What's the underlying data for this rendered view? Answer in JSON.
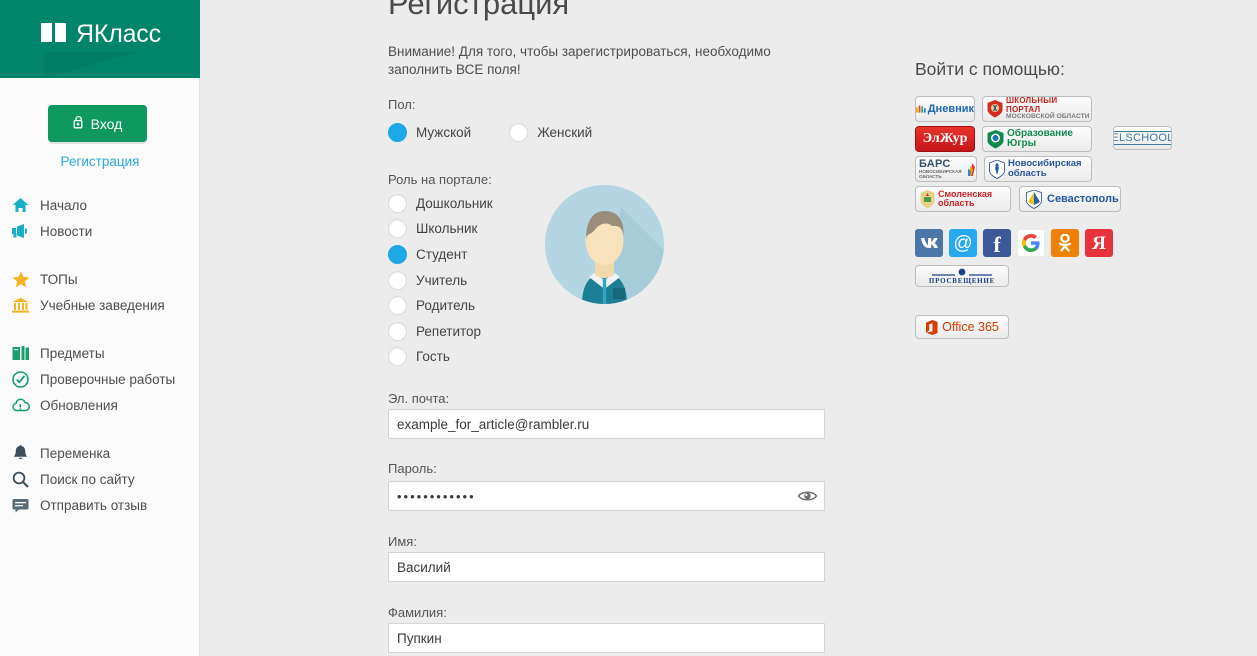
{
  "brand": {
    "logo_text": "ЯКласс",
    "logo_bg": "#00856b",
    "book_icon": "book-icon"
  },
  "sidebar": {
    "login_button": {
      "label": "Вход",
      "icon": "lock-icon",
      "color": "#0f9960"
    },
    "register_link": "Регистрация",
    "groups": [
      {
        "items": [
          {
            "label": "Начало",
            "icon": "home-icon",
            "color": "#17b0c6"
          },
          {
            "label": "Новости",
            "icon": "megaphone-icon",
            "color": "#17b0c6"
          }
        ]
      },
      {
        "items": [
          {
            "label": "ТОПы",
            "icon": "star-icon",
            "color": "#f5b324"
          },
          {
            "label": "Учебные заведения",
            "icon": "bank-icon",
            "color": "#f5b324"
          }
        ]
      },
      {
        "items": [
          {
            "label": "Предметы",
            "icon": "books-icon",
            "color": "#1a9e6e"
          },
          {
            "label": "Проверочные работы",
            "icon": "check-circle-icon",
            "color": "#1a9e6e"
          },
          {
            "label": "Обновления",
            "icon": "cloud-refresh-icon",
            "color": "#1a9e6e"
          }
        ]
      },
      {
        "items": [
          {
            "label": "Переменка",
            "icon": "bell-icon",
            "color": "#3d4f5c"
          },
          {
            "label": "Поиск по сайту",
            "icon": "search-icon",
            "color": "#3d4f5c"
          },
          {
            "label": "Отправить отзыв",
            "icon": "feedback-icon",
            "color": "#5a6b75"
          }
        ]
      }
    ]
  },
  "form": {
    "title": "Регистрация",
    "notice": "Внимание! Для того, чтобы зарегистрироваться, необходимо заполнить ВСЕ поля!",
    "gender": {
      "label": "Пол:",
      "options": [
        {
          "label": "Мужской",
          "checked": true
        },
        {
          "label": "Женский",
          "checked": false
        }
      ]
    },
    "role": {
      "label": "Роль на портале:",
      "options": [
        {
          "label": "Дошкольник",
          "checked": false
        },
        {
          "label": "Школьник",
          "checked": false
        },
        {
          "label": "Студент",
          "checked": true
        },
        {
          "label": "Учитель",
          "checked": false
        },
        {
          "label": "Родитель",
          "checked": false
        },
        {
          "label": "Репетитор",
          "checked": false
        },
        {
          "label": "Гость",
          "checked": false
        }
      ]
    },
    "email": {
      "label": "Эл. почта:",
      "value": "example_for_article@rambler.ru",
      "placeholder": ""
    },
    "password": {
      "label": "Пароль:",
      "value": "••••••••••••",
      "placeholder": "",
      "reveal_icon": "eye-icon"
    },
    "first_name": {
      "label": "Имя:",
      "value": "Василий",
      "placeholder": ""
    },
    "last_name": {
      "label": "Фамилия:",
      "value": "Пупкин",
      "placeholder": ""
    },
    "avatar": "student-avatar",
    "accent_color": "#1fa8e8"
  },
  "social": {
    "title": "Войти с помощью:",
    "providers": [
      {
        "name": "dnevnik",
        "label": "Дневник"
      },
      {
        "name": "shkolny-portal",
        "label": "ШКОЛЬНЫЙ ПОРТАЛ",
        "sub": "МОСКОВСКОЙ ОБЛАСТИ"
      },
      {
        "name": "elzhur",
        "label": "ЭлЖур"
      },
      {
        "name": "obrazovanie-ugry",
        "label": "Образование",
        "sub": "Югры"
      },
      {
        "name": "elschool",
        "label": "ELSCHOOL"
      },
      {
        "name": "bars",
        "label": "БАРС",
        "sub": "НОВОСИБИРСКАЯ ОБЛАСТЬ"
      },
      {
        "name": "novosibirskaya-oblast",
        "label": "Новосибирская",
        "sub": "область"
      },
      {
        "name": "smolenskaya-oblast",
        "label": "Смоленская",
        "sub": "область"
      },
      {
        "name": "sevastopol",
        "label": "Севастополь"
      },
      {
        "name": "prosveshchenie",
        "label": "ПРОСВЕЩЕНИЕ"
      },
      {
        "name": "office365",
        "label": "Office 365"
      }
    ],
    "networks": [
      {
        "name": "vk",
        "glyph": "VK",
        "color": "#4a76a8"
      },
      {
        "name": "mailru",
        "glyph": "@",
        "color": "#26a9f0"
      },
      {
        "name": "facebook",
        "glyph": "f",
        "color": "#3b5998"
      },
      {
        "name": "google",
        "glyph": "G",
        "color": "#ffffff"
      },
      {
        "name": "odnoklassniki",
        "glyph": "ok",
        "color": "#ee8208"
      },
      {
        "name": "yandex",
        "glyph": "Я",
        "color": "#e8323c"
      }
    ]
  }
}
